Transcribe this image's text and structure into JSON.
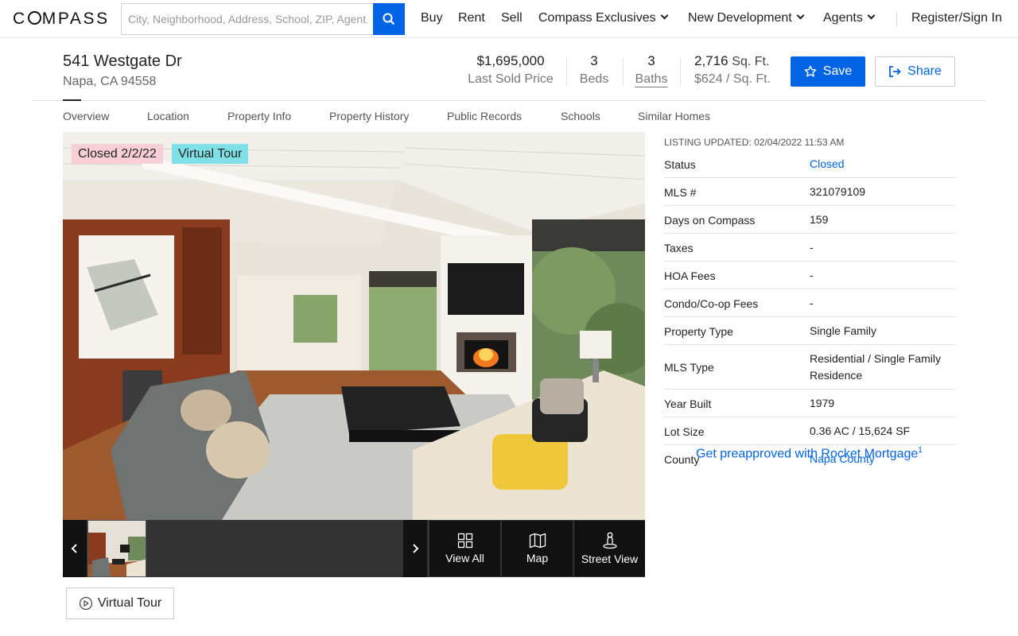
{
  "nav": {
    "logo": "COMPASS",
    "search_placeholder": "City, Neighborhood, Address, School, ZIP, Agent, ID",
    "links": [
      "Buy",
      "Rent",
      "Sell",
      "Compass Exclusives",
      "New Development",
      "Agents"
    ],
    "register": "Register/Sign In"
  },
  "listing": {
    "street": "541 Westgate Dr",
    "city": "Napa, CA 94558",
    "price": "$1,695,000",
    "price_label": "Last Sold Price",
    "beds": "3",
    "beds_label": "Beds",
    "baths": "3",
    "baths_label": "Baths",
    "sqft": "2,716",
    "sqft_unit": "Sq. Ft.",
    "price_per_sqft": "$624 / Sq. Ft.",
    "save_label": "Save",
    "share_label": "Share"
  },
  "tabs": [
    "Overview",
    "Location",
    "Property Info",
    "Property History",
    "Public Records",
    "Schools",
    "Similar Homes"
  ],
  "gallery": {
    "badge_closed": "Closed 2/2/22",
    "badge_tour": "Virtual Tour",
    "view_all": "View All",
    "map": "Map",
    "street_view": "Street View",
    "virtual_tour_button": "Virtual Tour"
  },
  "details": {
    "updated": "LISTING UPDATED: 02/04/2022 11:53 AM",
    "rows": [
      {
        "k": "Status",
        "v": "Closed"
      },
      {
        "k": "MLS #",
        "v": "321079109"
      },
      {
        "k": "Days on Compass",
        "v": "159"
      },
      {
        "k": "Taxes",
        "v": "-"
      },
      {
        "k": "HOA Fees",
        "v": "-"
      },
      {
        "k": "Condo/Co-op Fees",
        "v": "-"
      },
      {
        "k": "Property Type",
        "v": "Single Family"
      },
      {
        "k": "MLS Type",
        "v": "Residential / Single Family Residence"
      },
      {
        "k": "Year Built",
        "v": "1979"
      },
      {
        "k": "Lot Size",
        "v": "0.36 AC / 15,624 SF"
      },
      {
        "k": "County",
        "v": "Napa County"
      }
    ],
    "rocket": "Get preapproved with Rocket Mortgage",
    "rocket_sup": "1"
  },
  "colors": {
    "brand_blue": "#0064e5",
    "badge_closed_bg": "#f8cfd6",
    "badge_tour_bg": "#7fe0e6"
  }
}
